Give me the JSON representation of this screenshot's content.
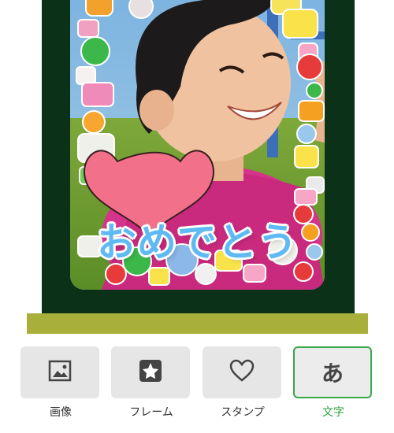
{
  "photo": {
    "caption": "おめでとう",
    "caption_color": "#5fb9f3",
    "heart_color": "#f2708a",
    "frame_style": "candy"
  },
  "colors": {
    "frame_background": "#0b3118",
    "strip": "#a8b03b",
    "active_tab": "#2fa23f"
  },
  "toolbar": {
    "items": [
      {
        "label": "画像",
        "icon": "image-icon"
      },
      {
        "label": "フレーム",
        "icon": "frame-star-icon"
      },
      {
        "label": "スタンプ",
        "icon": "heart-icon"
      },
      {
        "label": "文字",
        "icon": "text-a-icon",
        "glyph": "あ",
        "active": true
      }
    ]
  }
}
